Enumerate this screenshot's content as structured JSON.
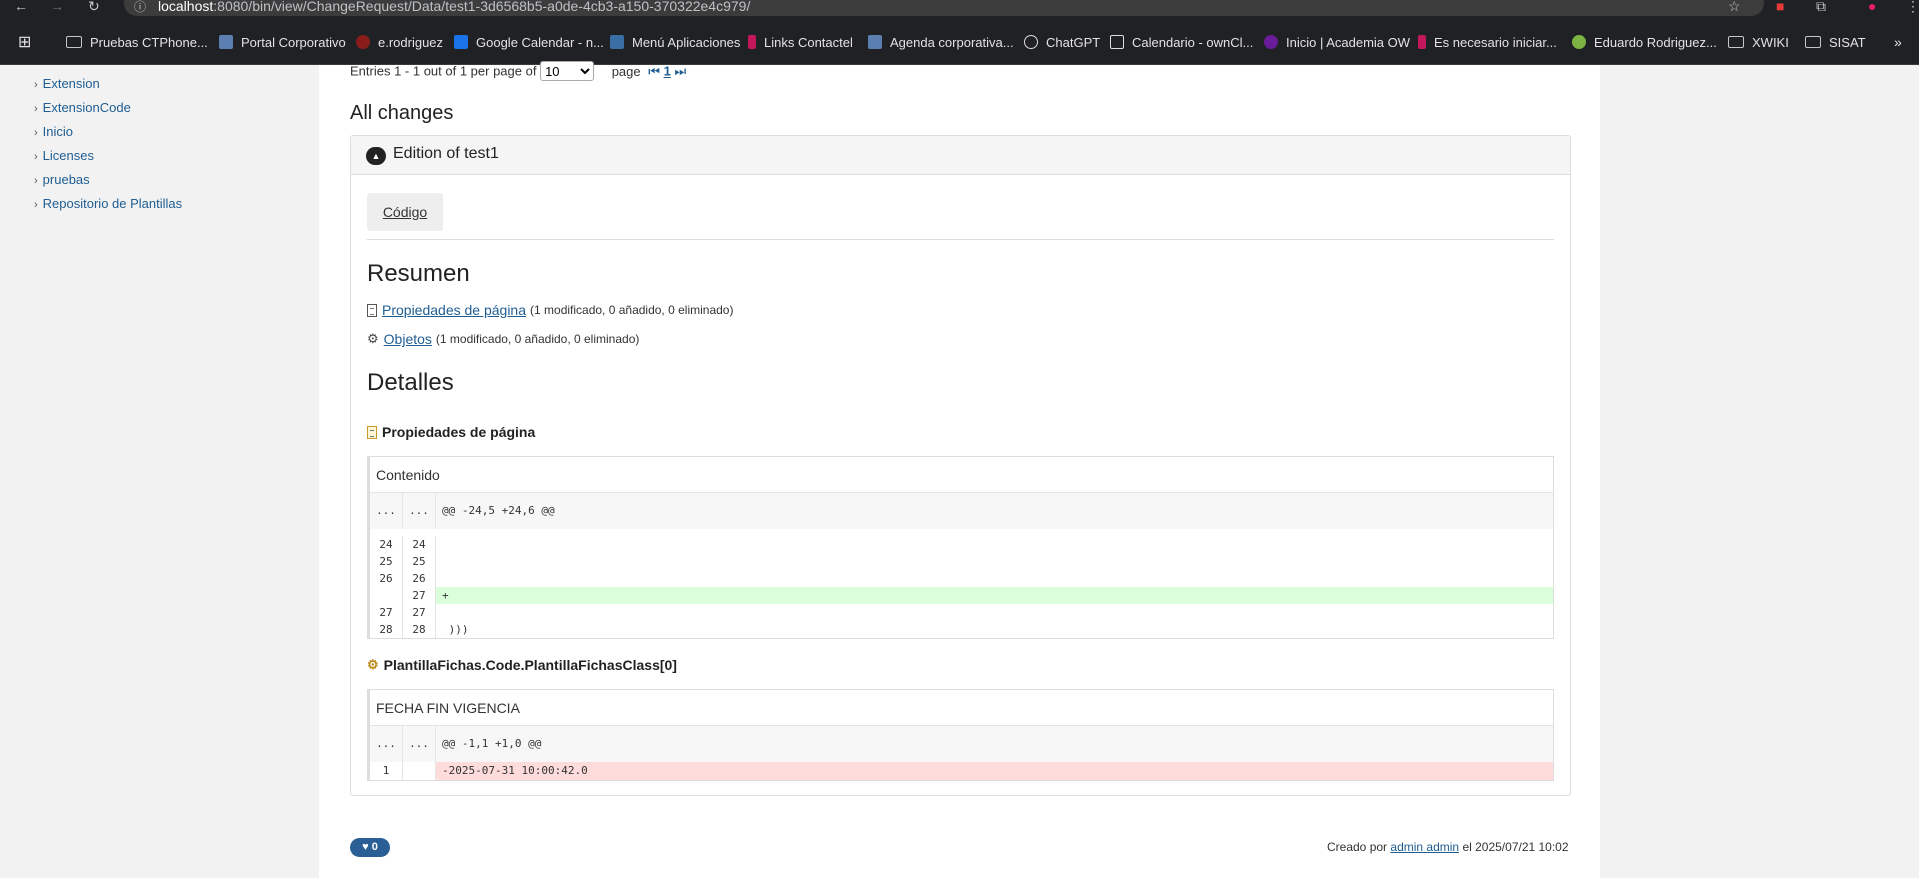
{
  "browser": {
    "url_host": "localhost",
    "url_rest": ":8080/bin/view/ChangeRequest/Data/test1-3d6568b5-a0de-4cb3-a150-370322e4c979/",
    "bookmarks": [
      {
        "label": "Pruebas CTPhone...",
        "icon": "folder-icon"
      },
      {
        "label": "Portal Corporativo",
        "icon": "site-icon"
      },
      {
        "label": "e.rodriguez",
        "icon": "site-icon"
      },
      {
        "label": "Google Calendar - n...",
        "icon": "calendar-icon"
      },
      {
        "label": "Menú Aplicaciones",
        "icon": "site-icon"
      },
      {
        "label": "Links Contactel",
        "icon": "site-icon"
      },
      {
        "label": "Agenda corporativa...",
        "icon": "site-icon"
      },
      {
        "label": "ChatGPT",
        "icon": "chatgpt-icon"
      },
      {
        "label": "Calendario - ownCl...",
        "icon": "calendar-icon"
      },
      {
        "label": "Inicio | Academia OW",
        "icon": "site-icon"
      },
      {
        "label": "Es necesario iniciar...",
        "icon": "site-icon"
      },
      {
        "label": "Eduardo Rodriguez...",
        "icon": "site-icon"
      },
      {
        "label": "XWIKI",
        "icon": "folder-icon"
      },
      {
        "label": "SISAT",
        "icon": "folder-icon"
      }
    ]
  },
  "sidebar": {
    "items": [
      {
        "label": "Extension"
      },
      {
        "label": "ExtensionCode"
      },
      {
        "label": "Inicio"
      },
      {
        "label": "Licenses"
      },
      {
        "label": "pruebas"
      },
      {
        "label": "Repositorio de Plantillas"
      }
    ]
  },
  "pager": {
    "entries_text": "Entries 1 - 1 out of 1 per page of",
    "per_page": "10",
    "page_label": "page",
    "current_page": "1"
  },
  "all_changes": {
    "heading": "All changes",
    "panel_title": "Edition of test1",
    "tab_label": "Código"
  },
  "resumen": {
    "heading": "Resumen",
    "lines": [
      {
        "link": "Propiedades de página",
        "detail": "(1 modificado, 0 añadido, 0 eliminado)"
      },
      {
        "link": "Objetos",
        "detail": "(1 modificado, 0 añadido, 0 eliminado)"
      }
    ]
  },
  "detalles": {
    "heading": "Detalles",
    "section1": {
      "title": "Propiedades de página",
      "field": "Contenido",
      "hunk": "@@ -24,5 +24,6 @@",
      "rows": [
        {
          "old": "24",
          "new": "24",
          "text": "",
          "type": "ctx"
        },
        {
          "old": "25",
          "new": "25",
          "text": "",
          "type": "ctx"
        },
        {
          "old": "26",
          "new": "26",
          "text": "",
          "type": "ctx"
        },
        {
          "old": "",
          "new": "27",
          "text": "+",
          "type": "add"
        },
        {
          "old": "27",
          "new": "27",
          "text": "",
          "type": "ctx"
        },
        {
          "old": "28",
          "new": "28",
          "text": " )))",
          "type": "ctx"
        }
      ]
    },
    "section2": {
      "title": "PlantillaFichas.Code.PlantillaFichasClass[0]",
      "field": "FECHA FIN VIGENCIA",
      "hunk": "@@ -1,1 +1,0 @@",
      "rows": [
        {
          "old": "1",
          "new": "",
          "text": "-2025-07-31 10:00:42.0",
          "type": "del"
        }
      ]
    }
  },
  "footer": {
    "likes": "0",
    "created_prefix": "Creado por",
    "author": "admin admin",
    "date_text": "el 2025/07/21 10:02"
  },
  "colors": {
    "added_bg": "#dbffdb",
    "removed_bg": "#ffdcdc",
    "link": "#1f5d92"
  }
}
